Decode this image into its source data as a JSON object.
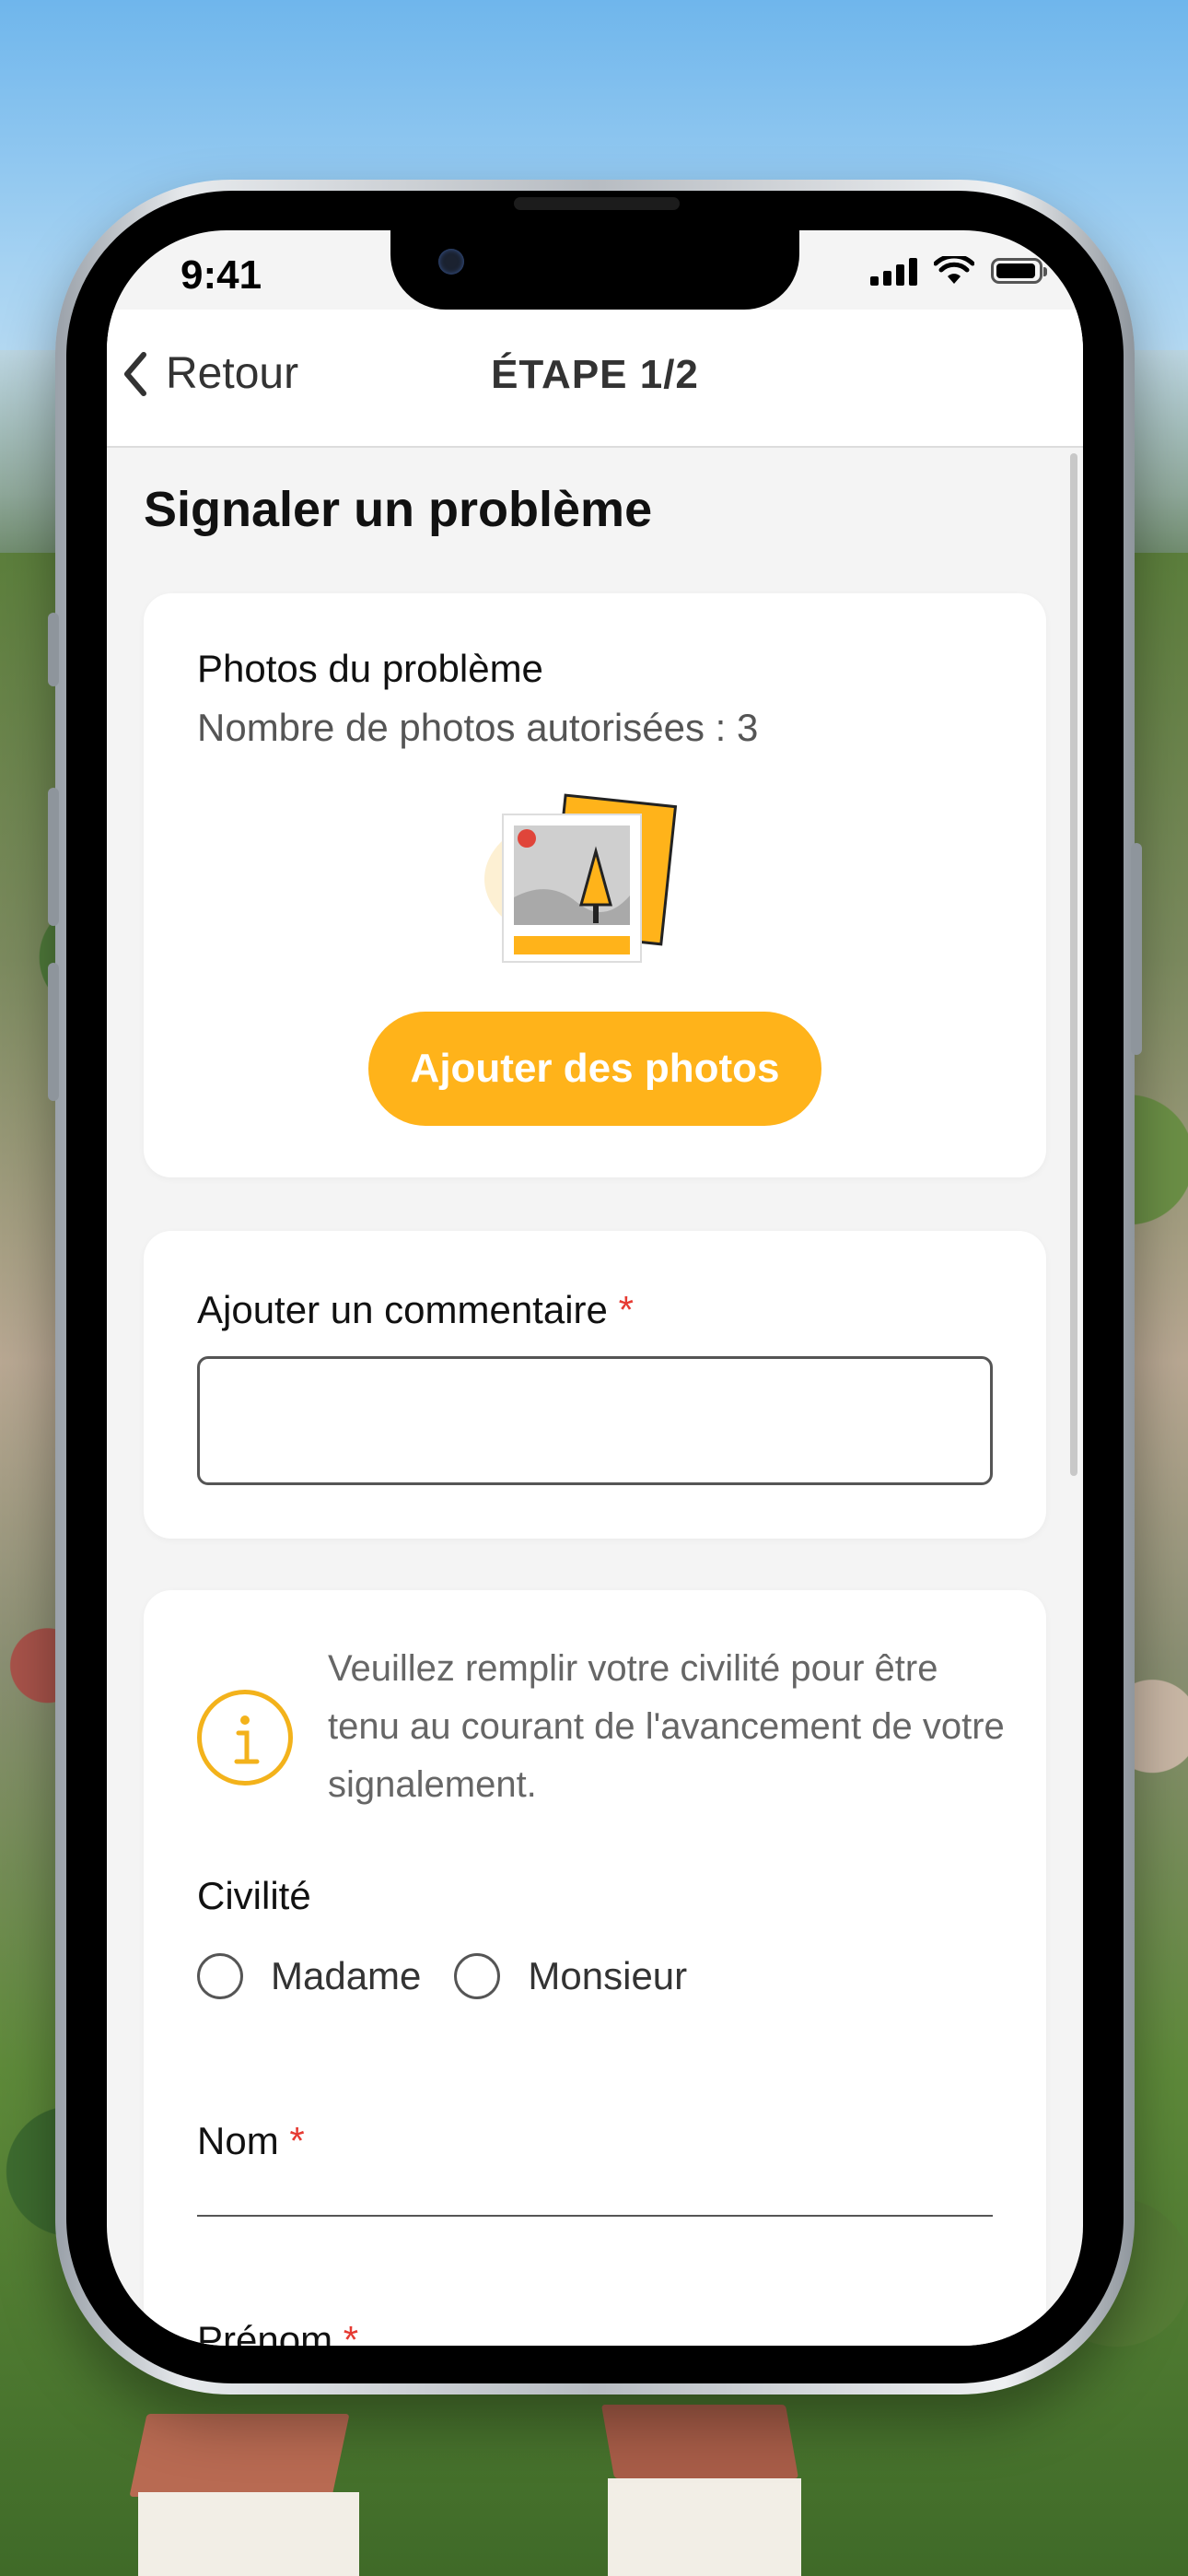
{
  "status_bar": {
    "time": "9:41"
  },
  "nav": {
    "back_label": "Retour",
    "title": "ÉTAPE 1/2"
  },
  "page": {
    "title": "Signaler un problème"
  },
  "photos_card": {
    "label": "Photos du problème",
    "allowed_text": "Nombre de photos autorisées : 3",
    "add_button": "Ajouter des photos"
  },
  "comment_card": {
    "label": "Ajouter un commentaire",
    "required_mark": "*",
    "value": ""
  },
  "civility_card": {
    "info_text": "Veuillez remplir votre civilité pour être tenu au courant de l'avancement de votre signalement.",
    "civility_label": "Civilité",
    "options": [
      "Madame",
      "Monsieur"
    ],
    "selected": null,
    "nom_label": "Nom",
    "prenom_label": "Prénom",
    "required_mark": "*"
  },
  "colors": {
    "accent": "#ffb31a",
    "required": "#e63a32",
    "info_icon": "#f3b21b"
  }
}
